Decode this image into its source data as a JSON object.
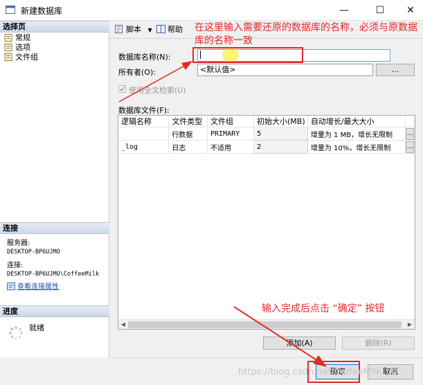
{
  "window": {
    "title": "新建数据库",
    "minimize": "—",
    "maximize": "☐",
    "close": "✕"
  },
  "left_panel": {
    "pages_header": "选择页",
    "pages": [
      {
        "label": "常规",
        "icon": "page-icon"
      },
      {
        "label": "选项",
        "icon": "page-icon"
      },
      {
        "label": "文件组",
        "icon": "page-icon"
      }
    ],
    "connection_header": "连接",
    "server_label": "服务器:",
    "server_value": "DESKTOP-BP6UJMO",
    "connection_label": "连接:",
    "connection_value": "DESKTOP-BP6UJMO\\CoffeeMilk",
    "view_conn_props": "查看连接属性",
    "progress_header": "进度",
    "progress_status": "就绪"
  },
  "toolbar": {
    "script_label": "脚本",
    "help_label": "帮助"
  },
  "form": {
    "db_name_label": "数据库名称(N):",
    "db_name_value": "",
    "owner_label": "所有者(O):",
    "owner_value": "<默认值>",
    "browse_label": "...",
    "fulltext_label": "使用全文检索(U)",
    "fulltext_checked": true,
    "files_label": "数据库文件(F):"
  },
  "files_grid": {
    "columns": [
      "逻辑名称",
      "文件类型",
      "文件组",
      "初始大小(MB)",
      "自动增长/最大大小"
    ],
    "rows": [
      [
        "",
        "行数据",
        "PRIMARY",
        "5",
        "增量为 1 MB，增长无限制"
      ],
      [
        "_log",
        "日志",
        "不适用",
        "2",
        "增量为 10%，增长无限制"
      ]
    ],
    "row_button": "..."
  },
  "buttons": {
    "add": "添加(A)",
    "remove": "删除(R)",
    "ok": "确定",
    "cancel": "取消"
  },
  "annotations": {
    "name_hint": "在这里输入需要还原的数据库的名称，必须与原数据库的名称一致",
    "ok_hint": "输入完成后点击 “确定” 按钮"
  },
  "watermark": "https://blog.csdn.net/CoffeeMilk_UA...",
  "colors": {
    "annotation_red": "#e5292a",
    "link_blue": "#1d4fa8",
    "header_blue": "#cdd8e8"
  }
}
